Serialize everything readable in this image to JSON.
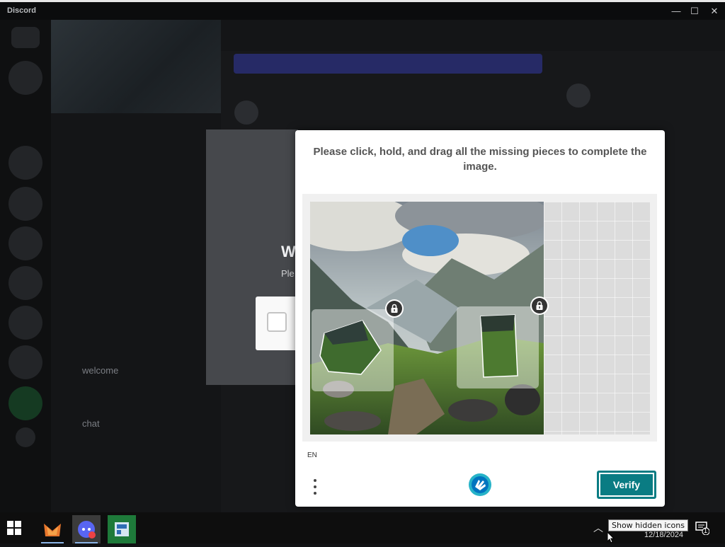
{
  "window": {
    "app_title": "Discord",
    "minimize_glyph": "—",
    "maximize_glyph": "☐",
    "close_glyph": "✕"
  },
  "background_channel": {
    "channel_welcome": "welcome",
    "channel_chat": "chat"
  },
  "underlying_dialog": {
    "title_partial": "W",
    "subtitle_partial": "Ple"
  },
  "captcha": {
    "prompt": "Please click, hold, and drag all the missing pieces to complete the image.",
    "language": "EN",
    "verify_label": "Verify",
    "menu_icon": "more-vertical-icon",
    "brand_icon": "hcaptcha-logo-icon",
    "accent_color": "#0a7c83"
  },
  "taskbar": {
    "clock_date": "12/18/2024",
    "tooltip": "Show hidden icons",
    "notification_count": "1",
    "start_icon": "windows-start-icon"
  }
}
